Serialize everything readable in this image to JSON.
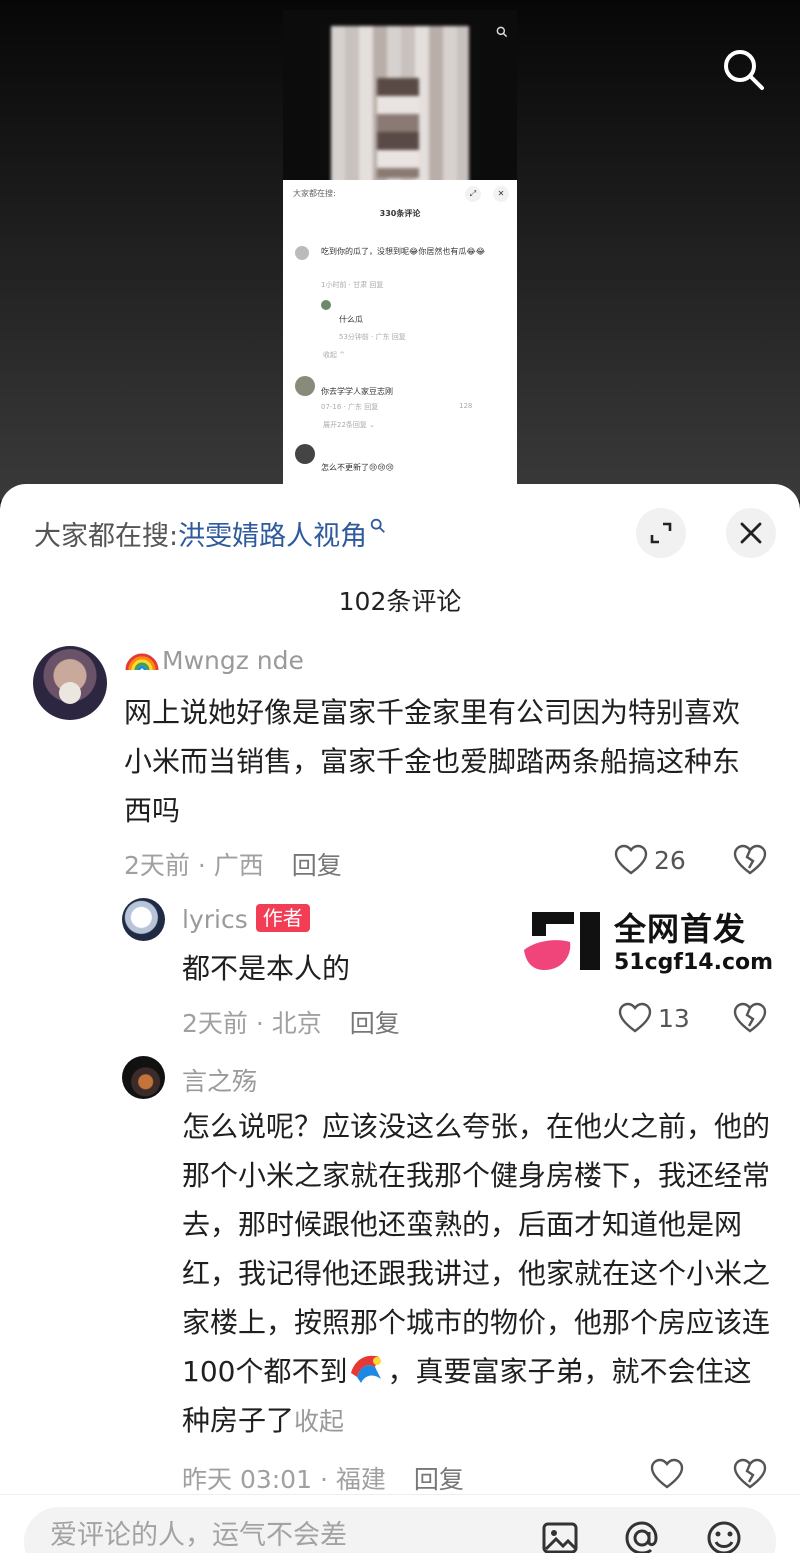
{
  "embedded_preview": {
    "search_prefix": "大家都在搜:",
    "comment_count": "330条评论",
    "comments": [
      {
        "text": "吃到你的瓜了，没想到呢😂你居然也有瓜😂😂",
        "meta": "1小时前 · 甘肃    回复"
      },
      {
        "text": "什么瓜",
        "meta": "53分钟前 · 广东    回复"
      },
      {
        "text": "收起 ^",
        "meta": ""
      },
      {
        "text": "你去学学人家豆志刚",
        "meta": "07-16 · 广东    回复",
        "likes": "128"
      },
      {
        "text": "展开22条回复 ⌄",
        "meta": ""
      },
      {
        "text": "怎么不更新了😢😢😢",
        "meta": ""
      }
    ]
  },
  "sheet": {
    "search_prefix": "大家都在搜:",
    "search_term": "洪雯婧路人视角",
    "comment_count": "102条评论"
  },
  "comments": [
    {
      "username": "Mwngz nde",
      "text": "网上说她好像是富家千金家里有公司因为特别喜欢小米而当销售，富家千金也爱脚踏两条船搞这种东西吗",
      "time_location": "2天前 · 广西",
      "reply_label": "回复",
      "likes": "26"
    },
    {
      "username": "lyrics",
      "author_tag": "作者",
      "text": "都不是本人的",
      "time_location": "2天前 · 北京",
      "reply_label": "回复",
      "likes": "13"
    },
    {
      "username": "言之殇",
      "text": "怎么说呢？应该没这么夸张，在他火之前，他的那个小米之家就在我那个健身房楼下，我还经常去，那时候跟他还蛮熟的，后面才知道他是网红，我记得他还跟我讲过，他家就在这个小米之家楼上，按照那个城市的物价，他那个房应该连100个都不到",
      "text_tail": "，真要富家子弟，就不会住这种房子了",
      "collapse_label": "收起",
      "time_location": "昨天 03:01 · 福建",
      "reply_label": "回复",
      "likes": ""
    }
  ],
  "watermark": {
    "line1": "全网首发",
    "line2": "51cgf14.com"
  },
  "input": {
    "placeholder": "爱评论的人，运气不会差"
  },
  "icons": [
    "search-icon",
    "expand-icon",
    "close-icon",
    "heart-icon",
    "broken-heart-icon",
    "image-icon",
    "at-icon",
    "emoji-icon"
  ],
  "colors": {
    "link": "#2f5a9e",
    "author_tag": "#f23d54",
    "watermark_pink": "#f0457a"
  }
}
